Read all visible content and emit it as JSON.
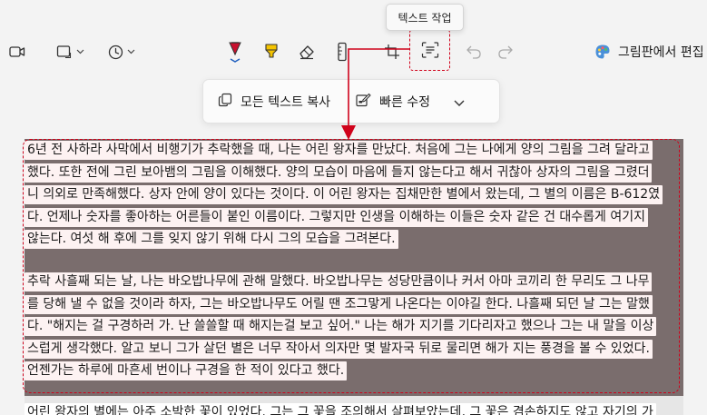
{
  "toolbar": {
    "tooltip": "텍스트 작업",
    "paint_label": "그림판에서 편집"
  },
  "icons": {
    "video": "video-camera-icon",
    "shape": "rectangle-shape-icon",
    "timer": "clock-icon",
    "pen": "red-ballpoint-pen-icon",
    "highlighter": "yellow-highlighter-icon",
    "eraser": "eraser-icon",
    "ruler": "ruler-icon",
    "crop": "crop-icon",
    "text_actions": "text-actions-icon",
    "undo": "undo-icon",
    "redo": "redo-icon",
    "paint": "paint-palette-icon"
  },
  "colors": {
    "accent_red": "#d0021b",
    "pen_red": "#c8102e",
    "highlighter_yellow": "#f5c400",
    "dim_overlay": "#7a6d6d",
    "text_highlight": "#fdf2f2"
  },
  "popup": {
    "copy_all_label": "모든 텍스트 복사",
    "quick_edit_label": "빠른 수정"
  },
  "paragraphs": [
    {
      "lines": [
        "6년 전 사하라 사막에서 비행기가 추락했을 때, 나는 어린 왕자를 만났다. 처음에 그는 나에게 양의 그림을 그려 달라고",
        "했다. 또한 전에 그린 보아뱀의 그림을 이해했다. 양의 모습이 마음에 들지 않는다고 해서 귀찮아 상자의 그림을 그렸더",
        "니 의외로 만족해했다. 상자 안에 양이 있다는 것이다. 이 어린 왕자는 집채만한 별에서 왔는데, 그 별의 이름은 B-612였",
        "다. 언제나 숫자를 좋아하는 어른들이 붙인 이름이다. 그렇지만 인생을 이해하는 이들은 숫자 같은 건 대수롭게 여기지",
        "않는다. 여섯 해 후에 그를 잊지 않기 위해 다시 그의 모습을 그려본다."
      ]
    },
    {
      "lines": [
        "추락 사흘째 되는 날, 나는 바오밥나무에 관해 말했다. 바오밥나무는 성당만큼이나 커서 아마 코끼리 한 무리도 그 나무",
        "를 당해 낼 수 없을 것이라 하자, 그는 바오밥나무도 어릴 땐 조그맣게 나온다는 이야길 한다. 나흘째 되던 날 그는 말했",
        "다. \"해지는 걸 구경하러 가. 난 쓸쓸할 때 해지는걸 보고 싶어.\" 나는 해가 지기를 기다리자고 했으나 그는 내 말을 이상",
        "스럽게 생각했다. 알고 보니 그가 살던 별은 너무 작아서 의자만 몇 발자국 뒤로 물리면 해가 지는 풍경을 볼 수 있었다.",
        "언젠가는 하루에 마흔세 번이나 구경을 한 적이 있다고 했다."
      ]
    },
    {
      "lines": [
        "어린 왕자의 별에는 아주 소박한 꽃이 있었다. 그는 그 꽃을 조의해서 살펴보았는데, 그 꽃은 겸손하지도 않고 자기의 가"
      ]
    }
  ]
}
